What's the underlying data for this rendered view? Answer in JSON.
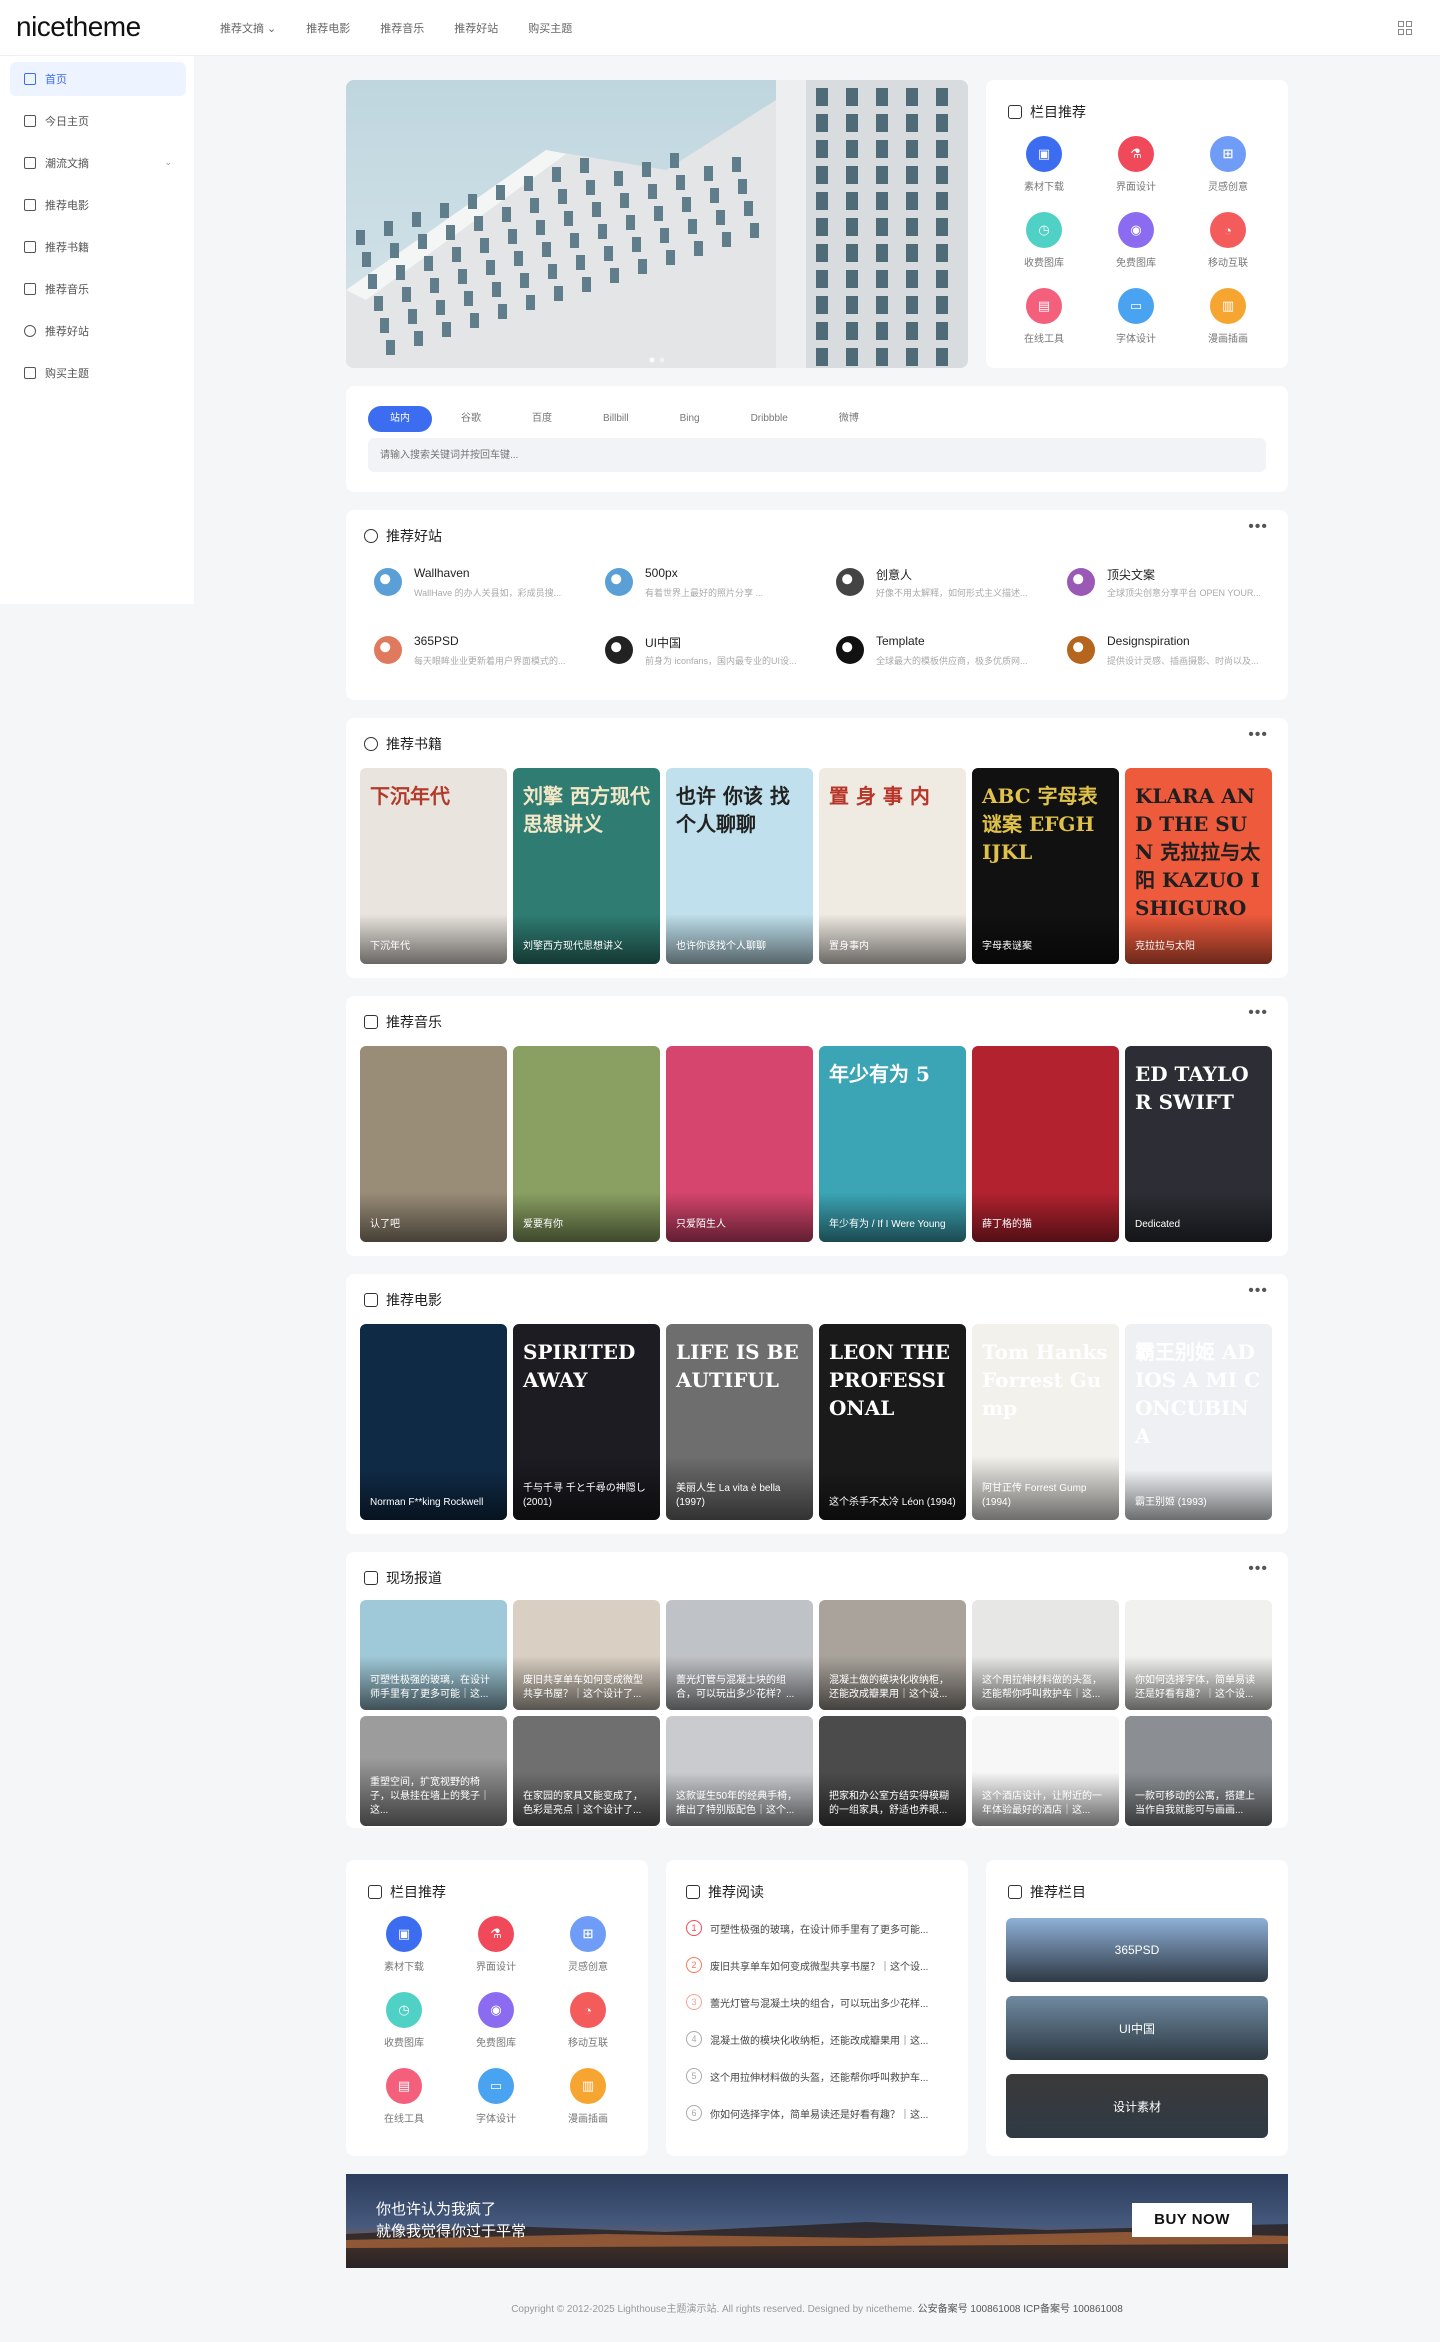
{
  "brand": {
    "logo": "nicetheme"
  },
  "topnav": [
    "推荐文摘 ⌄",
    "推荐电影",
    "推荐音乐",
    "推荐好站",
    "购买主题"
  ],
  "sidebar": {
    "items": [
      {
        "label": "首页",
        "icon": "home-icon",
        "active": true
      },
      {
        "label": "今日主页",
        "icon": "flask-icon"
      },
      {
        "label": "潮流文摘",
        "icon": "list-icon",
        "chevron": "⌄"
      },
      {
        "label": "推荐电影",
        "icon": "film-icon"
      },
      {
        "label": "推荐书籍",
        "icon": "book-icon"
      },
      {
        "label": "推荐音乐",
        "icon": "music-icon"
      },
      {
        "label": "推荐好站",
        "icon": "compass-icon"
      },
      {
        "label": "购买主题",
        "icon": "mail-icon"
      }
    ]
  },
  "category_card": {
    "title": "栏目推荐",
    "items": [
      {
        "label": "素材下载",
        "color": "#3c6df0",
        "glyph": "▣"
      },
      {
        "label": "界面设计",
        "color": "#f04a5a",
        "glyph": "⚗"
      },
      {
        "label": "灵感创意",
        "color": "#6f9cf7",
        "glyph": "⊞"
      },
      {
        "label": "收费图库",
        "color": "#4fd1c5",
        "glyph": "◷"
      },
      {
        "label": "免费图库",
        "color": "#8b6cf0",
        "glyph": "◉"
      },
      {
        "label": "移动互联",
        "color": "#f45c5c",
        "glyph": "◔"
      },
      {
        "label": "在线工具",
        "color": "#f4607c",
        "glyph": "▤"
      },
      {
        "label": "字体设计",
        "color": "#4aa3f0",
        "glyph": "▭"
      },
      {
        "label": "漫画插画",
        "color": "#f7a531",
        "glyph": "▥"
      }
    ]
  },
  "search": {
    "tabs": [
      "站内",
      "谷歌",
      "百度",
      "Billbill",
      "Bing",
      "Dribbble",
      "微博"
    ],
    "active": "站内",
    "placeholder": "请输入搜索关键词并按回车键..."
  },
  "sites": {
    "title": "推荐好站",
    "more": "•••",
    "items": [
      {
        "name": "Wallhaven",
        "desc": "WallHave 的办人关县如，彩成员搜...",
        "color": "#5aa0d6"
      },
      {
        "name": "500px",
        "desc": "有着世界上最好的照片分享 ...",
        "color": "#5aa0d6"
      },
      {
        "name": "创意人",
        "desc": "好像不用太解释，如何形式主义描述...",
        "color": "#444"
      },
      {
        "name": "顶尖文案",
        "desc": "全球顶尖创意分享平台 OPEN YOUR...",
        "color": "#9b59b6"
      },
      {
        "name": "365PSD",
        "desc": "每天眼眸业业更新着用户界面模式的...",
        "color": "#e07a5f"
      },
      {
        "name": "UI中国",
        "desc": "前身为 iconfans，国内最专业的UI设...",
        "color": "#222"
      },
      {
        "name": "Template",
        "desc": "全球最大的模板供应商，极多优质网...",
        "color": "#111"
      },
      {
        "name": "Designspiration",
        "desc": "提供设计灵感、插画摄影、时尚以及...",
        "color": "#b5651d"
      }
    ]
  },
  "books": {
    "title": "推荐书籍",
    "more": "•••",
    "items": [
      {
        "caption": "下沉年代",
        "cover_text": "下沉年代",
        "bg": "#e9e4de",
        "fg": "#b23a2a"
      },
      {
        "caption": "刘擎西方现代思想讲义",
        "cover_text": "刘擎 西方现代 思想讲义",
        "bg": "#2f7d72",
        "fg": "#f4e8c8"
      },
      {
        "caption": "也许你该找个人聊聊",
        "cover_text": "也许 你该 找个人聊聊",
        "bg": "#bfe0ec",
        "fg": "#222"
      },
      {
        "caption": "置身事内",
        "cover_text": "置 身 事 内",
        "bg": "#efeae2",
        "fg": "#b8352a"
      },
      {
        "caption": "字母表谜案",
        "cover_text": "ABC 字母表谜案 EFGH IJKL",
        "bg": "#111",
        "fg": "#e0c24a"
      },
      {
        "caption": "克拉拉与太阳",
        "cover_text": "KLARA AND THE SUN 克拉拉与太阳 KAZUO ISHIGURO",
        "bg": "#ee5a3c",
        "fg": "#1f1f1f"
      }
    ]
  },
  "music": {
    "title": "推荐音乐",
    "more": "•••",
    "items": [
      {
        "caption": "认了吧",
        "bg": "#9a8d78"
      },
      {
        "caption": "爱要有你",
        "bg": "#8aa062"
      },
      {
        "caption": "只爱陌生人",
        "bg": "#d6456d"
      },
      {
        "caption": "年少有为 / If I Were Young",
        "cover_text": "年少有为 5",
        "bg": "#3ca5b5"
      },
      {
        "caption": "薛丁格的猫",
        "bg": "#b3222f"
      },
      {
        "caption": "Dedicated",
        "cover_text": "ED TAYLOR SWIFT",
        "bg": "#2d2e35"
      }
    ]
  },
  "movies": {
    "title": "推荐电影",
    "more": "•••",
    "items": [
      {
        "caption": "Norman F**king Rockwell",
        "bg": "#0f2a45"
      },
      {
        "caption": "千与千寻 千と千尋の神隠し (2001)",
        "cover_text": "SPIRITED AWAY",
        "bg": "#1c1c22"
      },
      {
        "caption": "美丽人生 La vita è bella (1997)",
        "cover_text": "LIFE IS BEAUTIFUL",
        "bg": "#6e6e6e"
      },
      {
        "caption": "这个杀手不太冷 Léon (1994)",
        "cover_text": "LEON THE PROFESSIONAL",
        "bg": "#1a1a1a"
      },
      {
        "caption": "阿甘正传 Forrest Gump (1994)",
        "cover_text": "Tom Hanks Forrest Gump",
        "bg": "#f3f1ec"
      },
      {
        "caption": "霸王别姬 (1993)",
        "cover_text": "霸王别姬 ADIOS A MI CONCUBINA",
        "bg": "#eef0f4"
      }
    ]
  },
  "news": {
    "title": "现场报道",
    "more": "•••",
    "items": [
      {
        "caption": "可塑性极强的玻璃，在设计师手里有了更多可能｜这...",
        "bg": "#9fc9d8"
      },
      {
        "caption": "废旧共享单车如何变成微型共享书屋？｜这个设计了...",
        "bg": "#d9cfc2"
      },
      {
        "caption": "蕾光灯管与混凝土块的组合，可以玩出多少花样？...",
        "bg": "#bfc2c6"
      },
      {
        "caption": "混凝土做的模块化收纳柜，还能改成瓣果用｜这个设...",
        "bg": "#a9a39b"
      },
      {
        "caption": "这个用拉伸材料做的头盔，还能帮你呼叫救护车｜这...",
        "bg": "#e7e7e5"
      },
      {
        "caption": "你如何选择字体，简单易读还是好看有趣？｜这个设...",
        "bg": "#f1f1ef"
      },
      {
        "caption": "重塑空间，扩宽视野的椅子，以悬挂在墙上的凳子｜这...",
        "bg": "#9c9c9c"
      },
      {
        "caption": "在家园的家具又能变成了，色彩是亮点｜这个设计了...",
        "bg": "#6f6f6f"
      },
      {
        "caption": "这款诞生50年的经典手椅，推出了特别版配色｜这个...",
        "bg": "#c9cbcf"
      },
      {
        "caption": "把家和办公室方结实得模糊的一组家具，舒适也养眼...",
        "bg": "#4b4b4b"
      },
      {
        "caption": "这个酒店设计，让附近的一年体验最好的酒店｜这...",
        "bg": "#f7f7f7"
      },
      {
        "caption": "一款可移动的公寓，搭建上当作自我就能可与画画...",
        "bg": "#8b8f93"
      }
    ]
  },
  "bottom_category": {
    "title": "栏目推荐",
    "items": [
      {
        "label": "素材下载",
        "color": "#3c6df0",
        "glyph": "▣"
      },
      {
        "label": "界面设计",
        "color": "#f04a5a",
        "glyph": "⚗"
      },
      {
        "label": "灵感创意",
        "color": "#6f9cf7",
        "glyph": "⊞"
      },
      {
        "label": "收费图库",
        "color": "#4fd1c5",
        "glyph": "◷"
      },
      {
        "label": "免费图库",
        "color": "#8b6cf0",
        "glyph": "◉"
      },
      {
        "label": "移动互联",
        "color": "#f45c5c",
        "glyph": "◔"
      },
      {
        "label": "在线工具",
        "color": "#f4607c",
        "glyph": "▤"
      },
      {
        "label": "字体设计",
        "color": "#4aa3f0",
        "glyph": "▭"
      },
      {
        "label": "漫画插画",
        "color": "#f7a531",
        "glyph": "▥"
      }
    ]
  },
  "reading": {
    "title": "推荐阅读",
    "items": [
      {
        "num": "1",
        "text": "可塑性极强的玻璃，在设计师手里有了更多可能...",
        "color": "#f04a5a"
      },
      {
        "num": "2",
        "text": "废旧共享单车如何变成微型共享书屋？｜这个设...",
        "color": "#f47a5a"
      },
      {
        "num": "3",
        "text": "蕾光灯管与混凝土块的组合，可以玩出多少花样...",
        "color": "#f4a38f"
      },
      {
        "num": "4",
        "text": "混凝土做的模块化收纳柜，还能改成瓣果用｜这...",
        "color": "#aaa"
      },
      {
        "num": "5",
        "text": "这个用拉伸材料做的头盔，还能帮你呼叫救护车...",
        "color": "#aaa"
      },
      {
        "num": "6",
        "text": "你如何选择字体，简单易读还是好看有趣？｜这...",
        "color": "#aaa"
      }
    ]
  },
  "recommended_columns": {
    "title": "推荐栏目",
    "items": [
      {
        "label": "365PSD",
        "bg": "#8fb0d8"
      },
      {
        "label": "UI中国",
        "bg": "#6f8aa0"
      },
      {
        "label": "设计素材",
        "bg": "#3a3a3a"
      }
    ]
  },
  "ad": {
    "line1": "你也许认为我疯了",
    "line2": "就像我觉得你过于平常",
    "button": "BUY NOW"
  },
  "footer": {
    "text": "Copyright © 2012-2025 Lighthouse主题演示站. All rights reserved. Designed by nicetheme.",
    "beian": "公安备案号 100861008",
    "icp": "ICP备案号 100861008"
  }
}
